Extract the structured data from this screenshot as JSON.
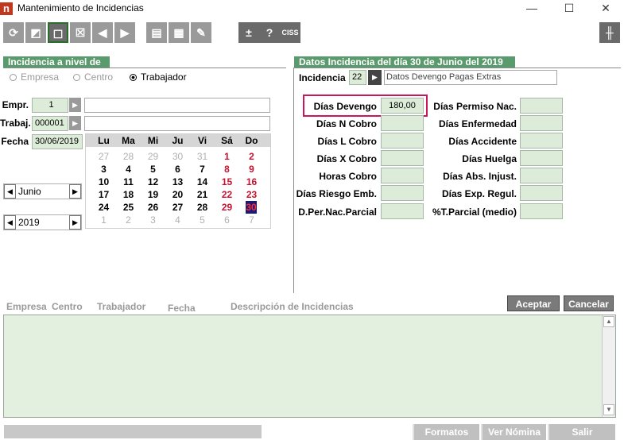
{
  "window": {
    "title": "Mantenimiento de Incidencias",
    "app_icon": "n",
    "minimize": "—",
    "maximize": "☐",
    "close": "✕"
  },
  "toolbar": {
    "help_label": "?",
    "plusminus_label": "±",
    "ciss_label": "CISS"
  },
  "left_group": {
    "title": "Incidencia a nivel de",
    "radio_empresa": "Empresa",
    "radio_centro": "Centro",
    "radio_trabajador": "Trabajador",
    "empr_label": "Empr.",
    "empr_value": "1",
    "trabaj_label": "Trabaj.",
    "trabaj_value": "000001",
    "fecha_label": "Fecha",
    "fecha_value": "30/06/2019",
    "month_value": "Junio",
    "year_value": "2019"
  },
  "calendar": {
    "headers": [
      "Lu",
      "Ma",
      "Mi",
      "Ju",
      "Vi",
      "Sá",
      "Do"
    ],
    "weeks": [
      [
        "27",
        "28",
        "29",
        "30",
        "31",
        "1",
        "2"
      ],
      [
        "3",
        "4",
        "5",
        "6",
        "7",
        "8",
        "9"
      ],
      [
        "10",
        "11",
        "12",
        "13",
        "14",
        "15",
        "16"
      ],
      [
        "17",
        "18",
        "19",
        "20",
        "21",
        "22",
        "23"
      ],
      [
        "24",
        "25",
        "26",
        "27",
        "28",
        "29",
        "30"
      ],
      [
        "1",
        "2",
        "3",
        "4",
        "5",
        "6",
        "7"
      ]
    ]
  },
  "right_group": {
    "title": "Datos Incidencia del día 30 de Junio del 2019",
    "incidencia_label": "Incidencia",
    "incidencia_value": "22",
    "incidencia_desc": "Datos Devengo Pagas Extras",
    "fields_left": [
      {
        "label": "Días Devengo",
        "value": "180,00"
      },
      {
        "label": "Días N Cobro",
        "value": ""
      },
      {
        "label": "Días L Cobro",
        "value": ""
      },
      {
        "label": "Días X Cobro",
        "value": ""
      },
      {
        "label": "Horas Cobro",
        "value": ""
      },
      {
        "label": "Días Riesgo Emb.",
        "value": ""
      },
      {
        "label": "D.Per.Nac.Parcial",
        "value": ""
      }
    ],
    "fields_right": [
      {
        "label": "Días Permiso Nac.",
        "value": ""
      },
      {
        "label": "Días Enfermedad",
        "value": ""
      },
      {
        "label": "Días Accidente",
        "value": ""
      },
      {
        "label": "Días Huelga",
        "value": ""
      },
      {
        "label": "Días Abs. Injust.",
        "value": ""
      },
      {
        "label": "Días Exp. Regul.",
        "value": ""
      },
      {
        "label": "%T.Parcial (medio)",
        "value": ""
      }
    ]
  },
  "list": {
    "columns": [
      "Empresa",
      "Centro",
      "Trabajador",
      "Fecha",
      "Descripción de Incidencias"
    ]
  },
  "buttons": {
    "aceptar": "Aceptar",
    "cancelar": "Cancelar",
    "formatos": "Formatos",
    "ver_nomina": "Ver Nómina",
    "salir": "Salir"
  },
  "colors": {
    "group_header": "#5a9b6e",
    "field_green": "#dcecd9",
    "highlight_border": "#c8185a"
  }
}
